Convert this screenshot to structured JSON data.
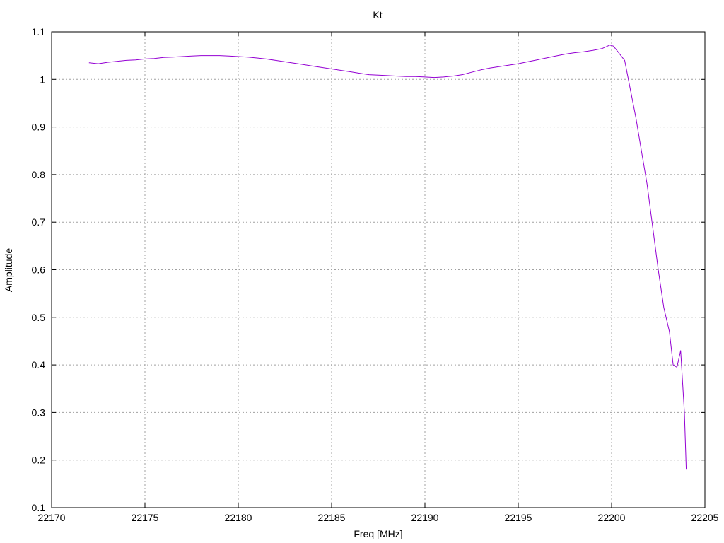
{
  "chart_data": {
    "type": "line",
    "title": "Kt",
    "xlabel": "Freq [MHz]",
    "ylabel": "Amplitude",
    "xlim": [
      22170,
      22205
    ],
    "ylim": [
      0.1,
      1.1
    ],
    "xticks": [
      22170,
      22175,
      22180,
      22185,
      22190,
      22195,
      22200,
      22205
    ],
    "yticks": [
      0.1,
      0.2,
      0.3,
      0.4,
      0.5,
      0.6,
      0.7,
      0.8,
      0.9,
      1,
      1.1
    ],
    "grid": true,
    "colors": {
      "series": "#9400d3",
      "grid": "#a0a0a0",
      "axes": "#000000"
    },
    "series": [
      {
        "x": [
          22172.0,
          22172.5,
          22173.0,
          22173.5,
          22174.0,
          22174.5,
          22175.0,
          22175.5,
          22176.0,
          22176.5,
          22177.0,
          22177.5,
          22178.0,
          22178.5,
          22179.0,
          22179.5,
          22180.0,
          22180.5,
          22181.0,
          22181.5,
          22182.0,
          22182.5,
          22183.0,
          22183.5,
          22184.0,
          22184.5,
          22185.0,
          22185.5,
          22186.0,
          22186.5,
          22187.0,
          22187.5,
          22188.0,
          22188.5,
          22189.0,
          22189.5,
          22190.0,
          22190.5,
          22191.0,
          22191.5,
          22192.0,
          22192.5,
          22193.0,
          22193.5,
          22194.0,
          22194.5,
          22195.0,
          22195.5,
          22196.0,
          22196.5,
          22197.0,
          22197.5,
          22198.0,
          22198.5,
          22199.0,
          22199.5,
          22199.9,
          22200.1,
          22200.4,
          22200.7,
          22201.0,
          22201.3,
          22201.6,
          22201.9,
          22202.2,
          22202.5,
          22202.8,
          22203.1,
          22203.3,
          22203.5,
          22203.7,
          22203.9,
          22204.0
        ],
        "values": [
          1.035,
          1.033,
          1.036,
          1.038,
          1.04,
          1.041,
          1.043,
          1.044,
          1.046,
          1.047,
          1.048,
          1.049,
          1.05,
          1.05,
          1.05,
          1.049,
          1.048,
          1.047,
          1.045,
          1.043,
          1.04,
          1.037,
          1.034,
          1.031,
          1.028,
          1.025,
          1.022,
          1.019,
          1.016,
          1.013,
          1.01,
          1.009,
          1.008,
          1.007,
          1.006,
          1.006,
          1.005,
          1.004,
          1.005,
          1.007,
          1.01,
          1.015,
          1.02,
          1.024,
          1.027,
          1.03,
          1.033,
          1.037,
          1.041,
          1.045,
          1.049,
          1.053,
          1.056,
          1.058,
          1.061,
          1.065,
          1.072,
          1.07,
          1.055,
          1.04,
          0.98,
          0.92,
          0.85,
          0.78,
          0.69,
          0.6,
          0.52,
          0.47,
          0.4,
          0.395,
          0.43,
          0.3,
          0.18
        ]
      }
    ]
  }
}
